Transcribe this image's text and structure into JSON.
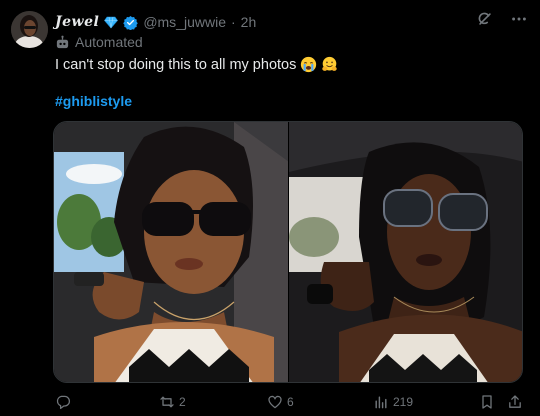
{
  "author": {
    "display_name": "Jewel",
    "handle": "@ms_juwwie",
    "separator": "·",
    "time": "2h",
    "automated_label": "Automated"
  },
  "tweet": {
    "text": "I can't stop doing this to all my photos",
    "hashtag": "#ghiblistyle",
    "emojis": [
      "crying-face",
      "hugging-face"
    ]
  },
  "media": {
    "count": 2,
    "items": [
      "ghibli-style-illustration",
      "original-selfie-photo"
    ]
  },
  "actions": {
    "replies": "",
    "reposts": "2",
    "likes": "6",
    "views": "219"
  },
  "colors": {
    "background": "#000000",
    "text": "#e7e9ea",
    "muted": "#71767b",
    "accent": "#1d9bf0"
  }
}
